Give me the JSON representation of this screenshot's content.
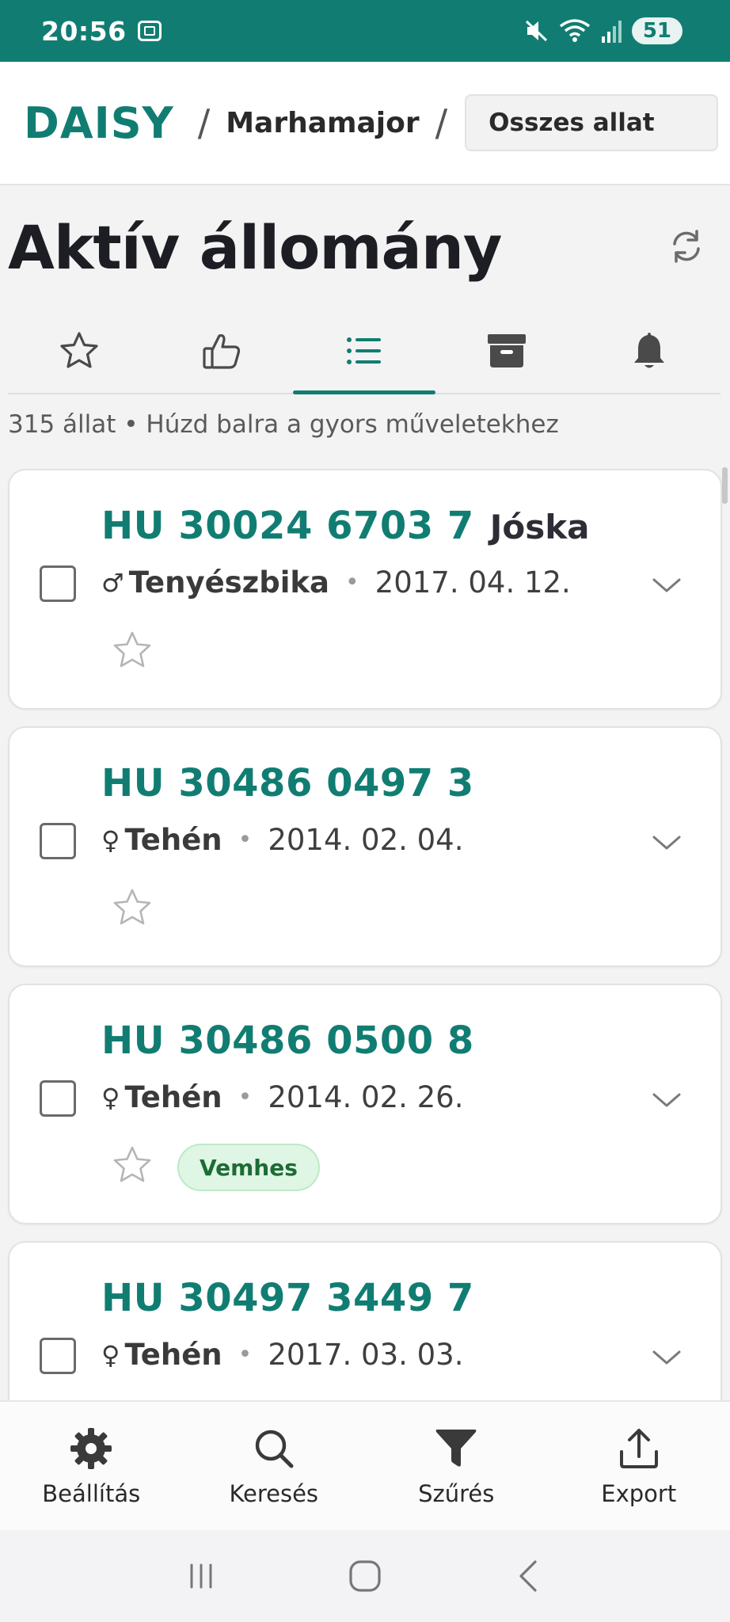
{
  "status_bar": {
    "time": "20:56",
    "battery": "51"
  },
  "header": {
    "brand": "DAISY",
    "separator": "/",
    "farm": "Marhamajor",
    "selector_value": "Osszes allat"
  },
  "page": {
    "title": "Aktív állomány",
    "hint": "315 állat • Húzd balra a gyors műveletekhez"
  },
  "tabs": [
    {
      "icon": "star-icon",
      "active": false
    },
    {
      "icon": "thumbs-up-icon",
      "active": false
    },
    {
      "icon": "list-icon",
      "active": true
    },
    {
      "icon": "archive-icon",
      "active": false
    },
    {
      "icon": "bell-icon",
      "active": false
    }
  ],
  "animals": [
    {
      "id": "HU 30024 6703 7",
      "name": "Jóska",
      "gender": "♂",
      "type": "Tenyészbika",
      "date": "2017. 04. 12.",
      "badge": ""
    },
    {
      "id": "HU 30486 0497 3",
      "name": "",
      "gender": "♀",
      "type": "Tehén",
      "date": "2014. 02. 04.",
      "badge": ""
    },
    {
      "id": "HU 30486 0500 8",
      "name": "",
      "gender": "♀",
      "type": "Tehén",
      "date": "2014. 02. 26.",
      "badge": "Vemhes"
    },
    {
      "id": "HU 30497 3449 7",
      "name": "",
      "gender": "♀",
      "type": "Tehén",
      "date": "2017. 03. 03.",
      "badge": ""
    }
  ],
  "meta_separator": "•",
  "actions": {
    "settings": "Beállítás",
    "search": "Keresés",
    "filter": "Szűrés",
    "export": "Export"
  },
  "colors": {
    "accent": "#117d72",
    "badge_bg": "#dff6e4",
    "badge_text": "#1e6b36"
  }
}
